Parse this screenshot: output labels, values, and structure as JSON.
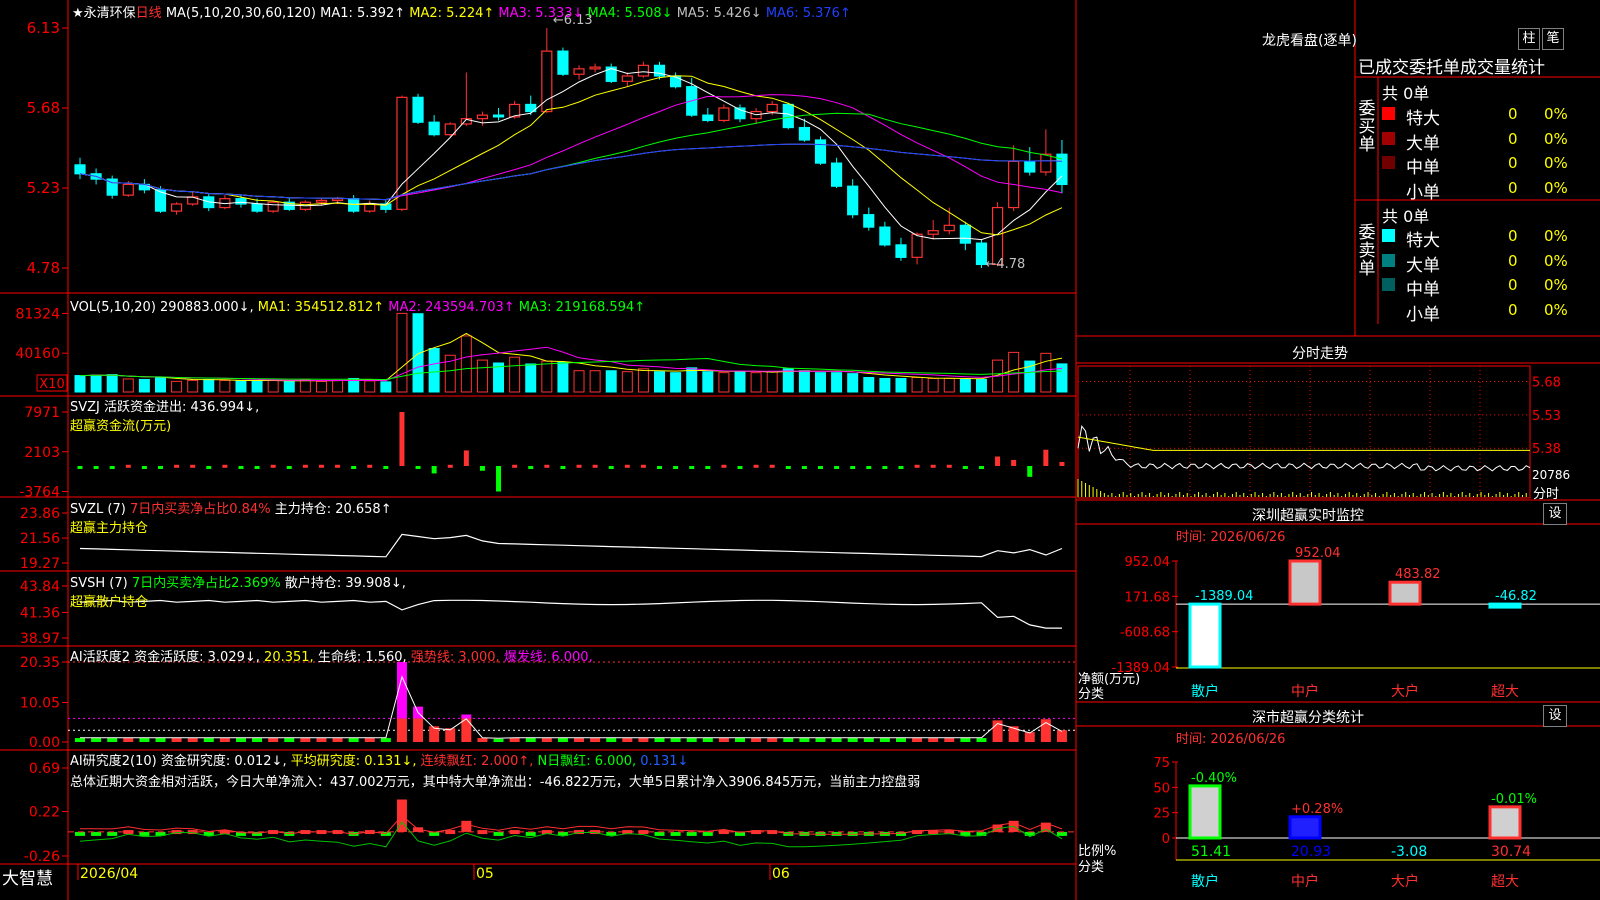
{
  "stock": {
    "name": "★永清环保",
    "period": "日线"
  },
  "kline": {
    "ma_text": "MA(5,10,20,30,60,120)",
    "ma_values": [
      {
        "label": "MA1: 5.392↑",
        "color": "#ffffff"
      },
      {
        "label": "MA2: 5.224↑",
        "color": "#ffff00"
      },
      {
        "label": "MA3: 5.333↓",
        "color": "#ff00ff"
      },
      {
        "label": "MA4: 5.508↓",
        "color": "#00ff00"
      },
      {
        "label": "MA5: 5.426↓",
        "color": "#c0c0c0"
      },
      {
        "label": "MA6: 5.376↑",
        "color": "#2040ff"
      }
    ],
    "y_ticks": [
      "6.13",
      "5.68",
      "5.23",
      "4.78"
    ],
    "high_label": "←6.13",
    "low_label": "←4.78"
  },
  "vol": {
    "title": "VOL(5,10,20) 290883.000↓,",
    "ma": [
      {
        "label": "MA1: 354512.812↑",
        "color": "#ffff00"
      },
      {
        "label": "MA2: 243594.703↑",
        "color": "#ff00ff"
      },
      {
        "label": "MA3: 219168.594↑",
        "color": "#00ff00"
      }
    ],
    "y_ticks": [
      "81324",
      "40160"
    ],
    "unit": "X10"
  },
  "svzj": {
    "title": "SVZJ  活跃资金进出: 436.994↓,",
    "sub": "超赢资金流(万元)",
    "y_ticks": [
      "7971",
      "2103",
      "-3764"
    ]
  },
  "svzl": {
    "title": "SVZL (7)",
    "t1": "7日内买卖净占比0.84%",
    "t2": "主力持仓: 20.658↑",
    "sub": "超赢主力持仓",
    "y_ticks": [
      "23.86",
      "21.56",
      "19.27"
    ]
  },
  "svsh": {
    "title": "SVSH (7)",
    "t1": "7日内买卖净占比2.369%",
    "t2": "散户持仓: 39.908↓,",
    "sub": "超赢散户持仓",
    "y_ticks": [
      "43.84",
      "41.36",
      "38.97"
    ]
  },
  "ai1": {
    "title": "AI活跃度2",
    "t1": "资金活跃度: 3.029↓,",
    "t2": "20.351,",
    "t3": "生命线: 1.560,",
    "t4": "强势线: 3.000,",
    "t5": "爆发线: 6.000,",
    "y_ticks": [
      "20.35",
      "10.05",
      "0.00"
    ]
  },
  "ai2": {
    "title": "AI研究度2(10)",
    "t1": "资金研究度: 0.012↓,",
    "t2": "平均研究度: 0.131↓,",
    "t3": "连续飘红: 2.000↑,",
    "t4": "N日飘红: 6.000,",
    "t5": "0.131↓",
    "summary": "总体近期大资金相对活跃，今日大单净流入：437.002万元，其中特大单净流出：-46.822万元，大单5日累计净入3906.845万元，当前主力控盘弱",
    "y_ticks": [
      "0.69",
      "0.22",
      "-0.26"
    ]
  },
  "xaxis": {
    "labels": [
      "2026/04",
      "05",
      "06"
    ]
  },
  "app_name": "大智慧",
  "right": {
    "lhkp_title": "龙虎看盘(逐单)",
    "tab_zhu": "柱",
    "tab_bi": "笔",
    "table_header": "已成交委托单成交量统计",
    "buy_side": {
      "label": "委买单",
      "total": "共 0单",
      "rows": [
        {
          "name": "特大",
          "count": "0",
          "pct": "0%",
          "color": "#ff0000"
        },
        {
          "name": "大单",
          "count": "0",
          "pct": "0%",
          "color": "#a00000"
        },
        {
          "name": "中单",
          "count": "0",
          "pct": "0%",
          "color": "#700000"
        },
        {
          "name": "小单",
          "count": "0",
          "pct": "0%",
          "color": ""
        }
      ]
    },
    "sell_side": {
      "label": "委卖单",
      "total": "共 0单",
      "rows": [
        {
          "name": "特大",
          "count": "0",
          "pct": "0%",
          "color": "#00ffff"
        },
        {
          "name": "大单",
          "count": "0",
          "pct": "0%",
          "color": "#008080"
        },
        {
          "name": "中单",
          "count": "0",
          "pct": "0%",
          "color": "#006060"
        },
        {
          "name": "小单",
          "count": "0",
          "pct": "0%",
          "color": ""
        }
      ]
    },
    "fenshi_title": "分时走势",
    "fenshi_ticks": [
      "5.68",
      "5.53",
      "5.38",
      "20786"
    ],
    "fenshi_unit": "分时",
    "monitor_title": "深圳超赢实时监控",
    "monitor_time": "时间: 2026/06/26",
    "monitor_btn": "设",
    "monitor_ticks": [
      "952.04",
      "171.68",
      "-608.68",
      "-1389.04"
    ],
    "monitor_ylabel": "净额(万元)",
    "monitor_xlabel": "分类",
    "monitor_bars": [
      {
        "cat": "散户",
        "value": -1389.04,
        "label": "-1389.04"
      },
      {
        "cat": "中户",
        "value": 952.04,
        "label": "952.04"
      },
      {
        "cat": "大户",
        "value": 483.82,
        "label": "483.82"
      },
      {
        "cat": "超大",
        "value": -46.82,
        "label": "-46.82"
      }
    ],
    "class_title": "深市超赢分类统计",
    "class_time": "时间: 2026/06/26",
    "class_btn": "设",
    "class_ticks": [
      "75",
      "50",
      "25",
      "0"
    ],
    "class_ylabel": "比例%",
    "class_xlabel": "分类",
    "class_bars": [
      {
        "cat": "散户",
        "value": 51.41,
        "top": "-0.40%",
        "bottom": "51.41"
      },
      {
        "cat": "中户",
        "value": 20.93,
        "top": "+0.28%",
        "bottom": "20.93"
      },
      {
        "cat": "大户",
        "value": -3.08,
        "top": "",
        "bottom": "-3.08"
      },
      {
        "cat": "超大",
        "value": 30.74,
        "top": "-0.01%",
        "bottom": "30.74"
      }
    ]
  },
  "colors": {
    "up": "#ff3232",
    "down": "#00ffff",
    "grid": "#c00000",
    "axis": "#ff0000"
  },
  "chart_data": {
    "type": "candlestick",
    "series_note": "approx daily OHLC read from chart",
    "ohlc": [
      [
        5.36,
        5.4,
        5.28,
        5.31
      ],
      [
        5.31,
        5.34,
        5.25,
        5.28
      ],
      [
        5.28,
        5.3,
        5.17,
        5.19
      ],
      [
        5.19,
        5.27,
        5.18,
        5.25
      ],
      [
        5.25,
        5.28,
        5.2,
        5.22
      ],
      [
        5.22,
        5.24,
        5.09,
        5.1
      ],
      [
        5.1,
        5.15,
        5.08,
        5.14
      ],
      [
        5.14,
        5.21,
        5.13,
        5.18
      ],
      [
        5.18,
        5.2,
        5.1,
        5.12
      ],
      [
        5.12,
        5.19,
        5.11,
        5.17
      ],
      [
        5.17,
        5.19,
        5.12,
        5.14
      ],
      [
        5.14,
        5.17,
        5.09,
        5.1
      ],
      [
        5.1,
        5.16,
        5.09,
        5.15
      ],
      [
        5.15,
        5.17,
        5.1,
        5.11
      ],
      [
        5.11,
        5.16,
        5.1,
        5.15
      ],
      [
        5.15,
        5.17,
        5.13,
        5.16
      ],
      [
        5.16,
        5.18,
        5.14,
        5.17
      ],
      [
        5.17,
        5.19,
        5.09,
        5.1
      ],
      [
        5.1,
        5.16,
        5.09,
        5.14
      ],
      [
        5.14,
        5.16,
        5.09,
        5.11
      ],
      [
        5.11,
        5.75,
        5.1,
        5.74
      ],
      [
        5.74,
        5.76,
        5.59,
        5.6
      ],
      [
        5.6,
        5.64,
        5.52,
        5.53
      ],
      [
        5.53,
        5.6,
        5.52,
        5.59
      ],
      [
        5.59,
        5.88,
        5.58,
        5.62
      ],
      [
        5.62,
        5.66,
        5.58,
        5.64
      ],
      [
        5.64,
        5.68,
        5.61,
        5.63
      ],
      [
        5.63,
        5.72,
        5.62,
        5.7
      ],
      [
        5.7,
        5.75,
        5.64,
        5.66
      ],
      [
        5.66,
        6.13,
        5.65,
        6.0
      ],
      [
        6.0,
        6.02,
        5.86,
        5.87
      ],
      [
        5.87,
        5.92,
        5.84,
        5.9
      ],
      [
        5.9,
        5.93,
        5.88,
        5.91
      ],
      [
        5.91,
        5.93,
        5.82,
        5.83
      ],
      [
        5.83,
        5.88,
        5.8,
        5.86
      ],
      [
        5.86,
        5.94,
        5.85,
        5.92
      ],
      [
        5.92,
        5.94,
        5.84,
        5.86
      ],
      [
        5.86,
        5.88,
        5.79,
        5.8
      ],
      [
        5.8,
        5.85,
        5.63,
        5.64
      ],
      [
        5.64,
        5.68,
        5.6,
        5.61
      ],
      [
        5.61,
        5.7,
        5.6,
        5.68
      ],
      [
        5.68,
        5.7,
        5.6,
        5.62
      ],
      [
        5.62,
        5.68,
        5.59,
        5.66
      ],
      [
        5.66,
        5.72,
        5.64,
        5.7
      ],
      [
        5.7,
        5.71,
        5.56,
        5.57
      ],
      [
        5.57,
        5.62,
        5.49,
        5.5
      ],
      [
        5.5,
        5.52,
        5.36,
        5.37
      ],
      [
        5.37,
        5.4,
        5.23,
        5.24
      ],
      [
        5.24,
        5.28,
        5.06,
        5.08
      ],
      [
        5.08,
        5.12,
        4.99,
        5.01
      ],
      [
        5.01,
        5.04,
        4.9,
        4.91
      ],
      [
        4.91,
        4.95,
        4.82,
        4.84
      ],
      [
        4.84,
        4.98,
        4.8,
        4.97
      ],
      [
        4.97,
        5.05,
        4.94,
        4.99
      ],
      [
        4.99,
        5.12,
        4.97,
        5.02
      ],
      [
        5.02,
        5.04,
        4.88,
        4.92
      ],
      [
        4.92,
        4.94,
        4.78,
        4.8
      ],
      [
        4.8,
        5.15,
        4.79,
        5.12
      ],
      [
        5.12,
        5.47,
        5.1,
        5.38
      ],
      [
        5.38,
        5.46,
        5.3,
        5.32
      ],
      [
        5.32,
        5.56,
        5.3,
        5.42
      ],
      [
        5.42,
        5.5,
        5.2,
        5.25
      ]
    ]
  }
}
